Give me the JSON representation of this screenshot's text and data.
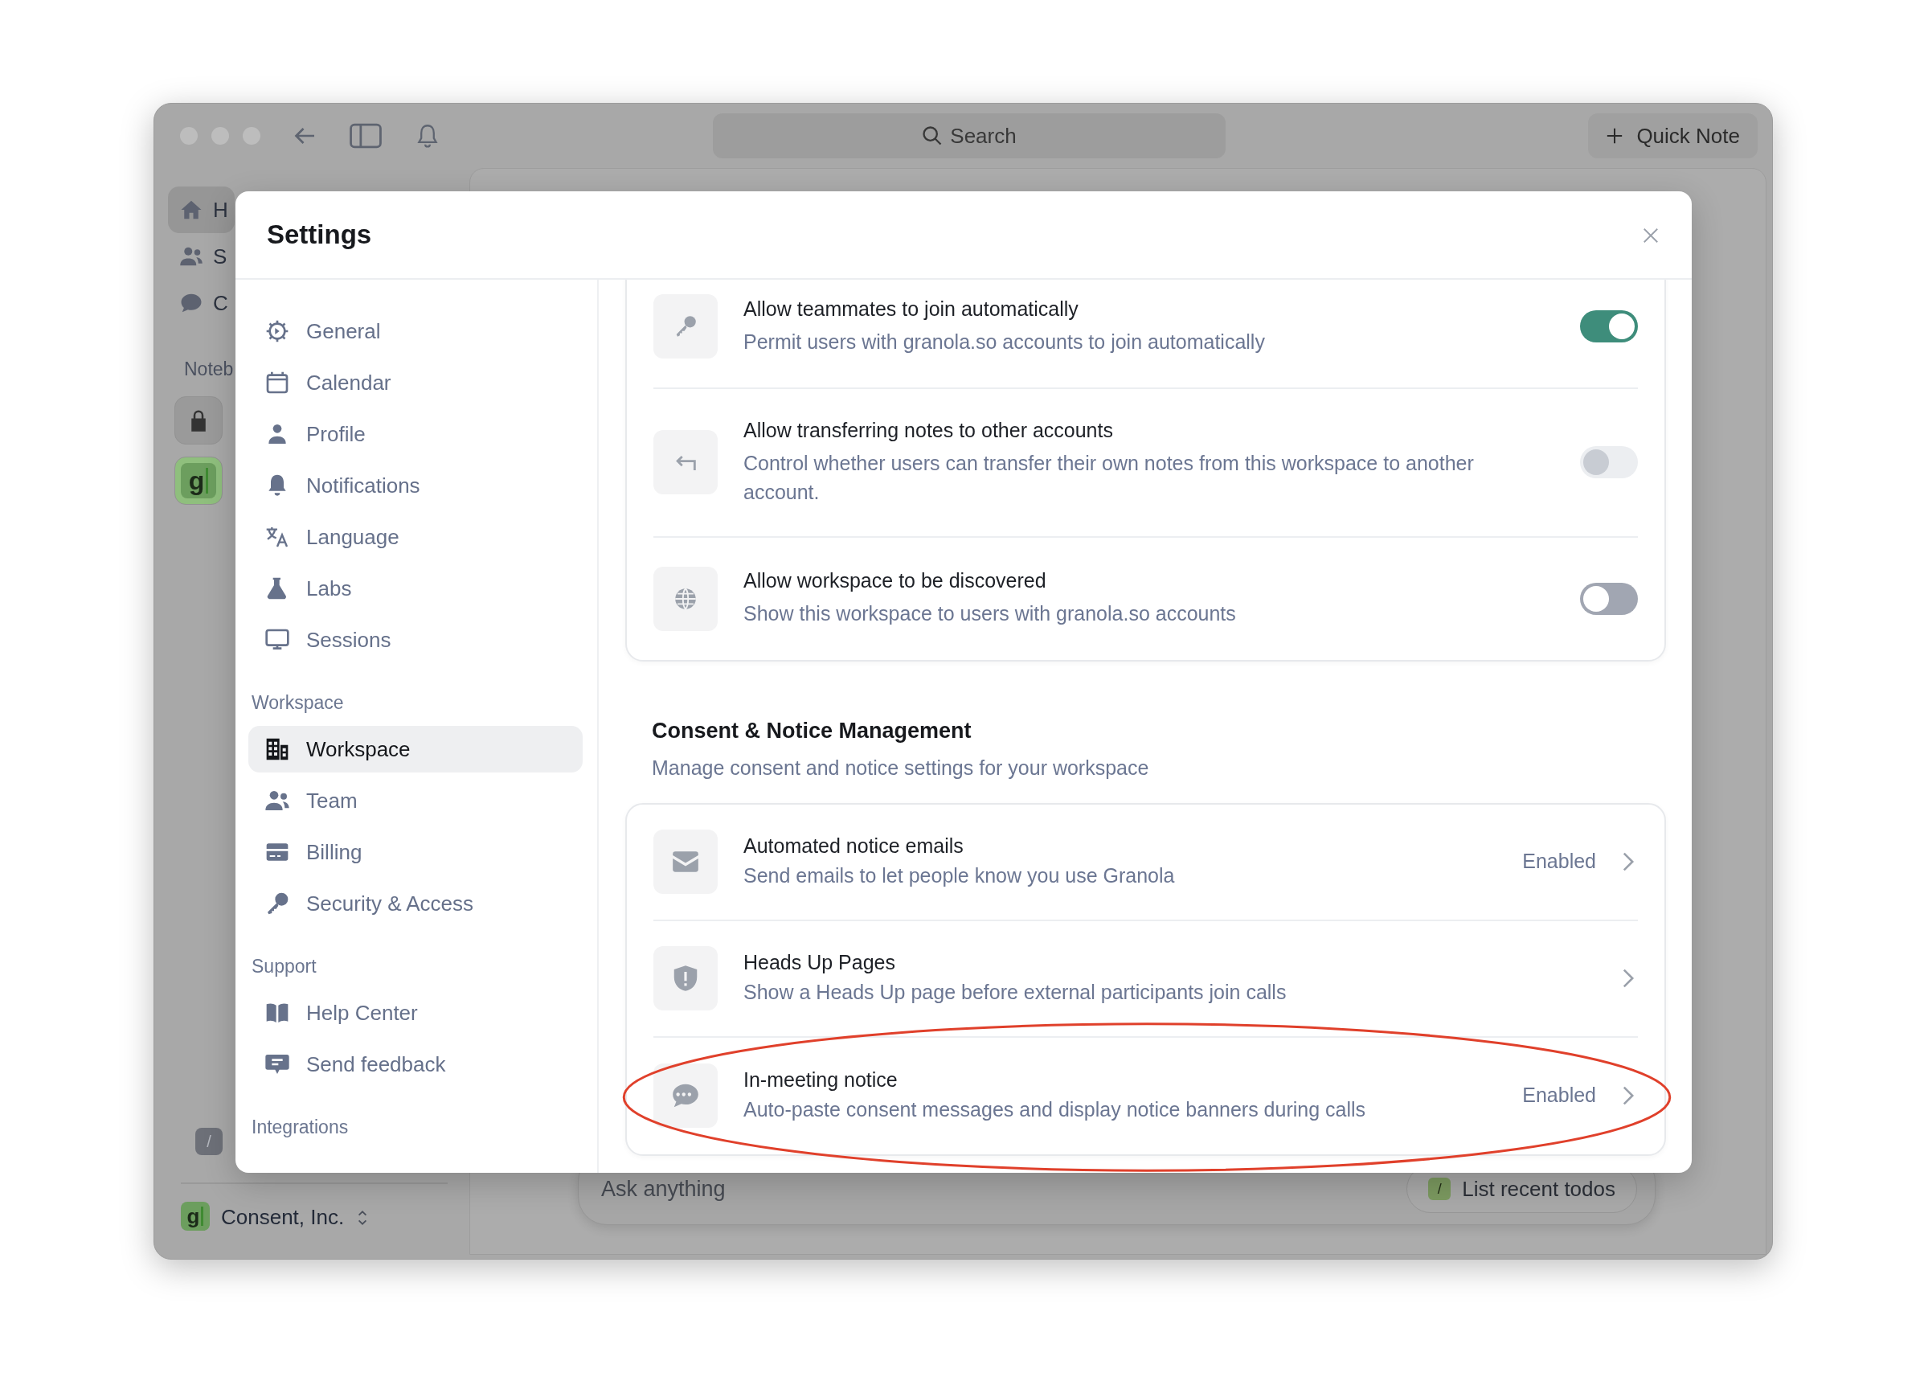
{
  "app": {
    "toolbar": {
      "search": "Search",
      "quick_note": "Quick Note"
    },
    "sidebar": {
      "items": [
        {
          "label": "H",
          "selected": true
        },
        {
          "label": "S",
          "selected": false
        },
        {
          "label": "C",
          "selected": false
        }
      ],
      "section": "Noteb",
      "notebooks": [
        {
          "kind": "locked"
        },
        {
          "kind": "logo",
          "logo": "g"
        }
      ],
      "shortcut_key": "/",
      "workspace": {
        "logo": "g",
        "name": "Consent, Inc."
      }
    },
    "composer": {
      "placeholder": "Ask anything",
      "suggestion_key": "/",
      "suggestion": "List recent todos"
    }
  },
  "settings": {
    "title": "Settings",
    "nav": [
      {
        "kind": "item",
        "label": "General",
        "selected": false
      },
      {
        "kind": "item",
        "label": "Calendar",
        "selected": false
      },
      {
        "kind": "item",
        "label": "Profile",
        "selected": false
      },
      {
        "kind": "item",
        "label": "Notifications",
        "selected": false
      },
      {
        "kind": "item",
        "label": "Language",
        "selected": false
      },
      {
        "kind": "item",
        "label": "Labs",
        "selected": false
      },
      {
        "kind": "item",
        "label": "Sessions",
        "selected": false
      },
      {
        "kind": "header",
        "label": "Workspace"
      },
      {
        "kind": "item",
        "label": "Workspace",
        "selected": true
      },
      {
        "kind": "item",
        "label": "Team",
        "selected": false
      },
      {
        "kind": "item",
        "label": "Billing",
        "selected": false
      },
      {
        "kind": "item",
        "label": "Security & Access",
        "selected": false
      },
      {
        "kind": "header",
        "label": "Support"
      },
      {
        "kind": "item",
        "label": "Help Center",
        "selected": false
      },
      {
        "kind": "item",
        "label": "Send feedback",
        "selected": false
      },
      {
        "kind": "header",
        "label": "Integrations"
      }
    ],
    "workspace_settings": [
      {
        "title": "Allow teammates to join automatically",
        "description": "Permit users with granola.so accounts to join automatically",
        "on": true,
        "disabled": false
      },
      {
        "title": "Allow transferring notes to other accounts",
        "description": "Control whether users can transfer their own notes from this workspace to another account.",
        "on": false,
        "disabled": true
      },
      {
        "title": "Allow workspace to be discovered",
        "description": "Show this workspace to users with granola.so accounts",
        "on": false,
        "disabled": false
      }
    ],
    "section": {
      "title": "Consent & Notice Management",
      "subtitle": "Manage consent and notice settings for your workspace"
    },
    "consent_rows": [
      {
        "title": "Automated notice emails",
        "description": "Send emails to let people know you use Granola",
        "status": "Enabled",
        "circled": false
      },
      {
        "title": "Heads Up Pages",
        "description": "Show a Heads Up page before external participants join calls",
        "circled": false
      },
      {
        "title": "In-meeting notice",
        "description": "Auto-paste consent messages and display notice banners during calls",
        "status": "Enabled",
        "circled": true
      }
    ]
  }
}
